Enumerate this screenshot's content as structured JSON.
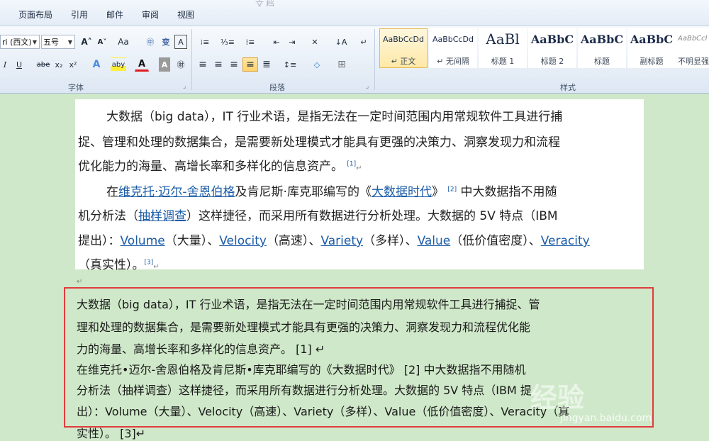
{
  "title_fragment": "文档",
  "tabs": [
    "页面布局",
    "引用",
    "邮件",
    "审阅",
    "视图"
  ],
  "font": {
    "name_value": "ri (西文)",
    "size_value": "五号",
    "grow": "A˄",
    "shrink": "A˅",
    "case": "Aa",
    "phonetic": "㊥",
    "clear_format": "变",
    "border_char": "A"
  },
  "font_row2": {
    "italic": "I",
    "underline": "U",
    "strike": "abe",
    "subscript": "x₂",
    "superscript": "x²",
    "effects": "A",
    "highlight": "aby",
    "color": "A",
    "shading": "A",
    "encircle": "㊖"
  },
  "paragraph_glyphs": {
    "bullets": "⁝≡",
    "numbering": "⅓≡",
    "multilevel": "⁞≡",
    "decrease_indent": "⇤",
    "increase_indent": "⇥",
    "chinese_layout": "✕",
    "sort": "↓A",
    "show_marks": "↵",
    "align_left": "≡",
    "align_center": "≡",
    "align_right": "≡",
    "justify": "≡",
    "distributed": "≣",
    "line_spacing": "↕≡",
    "paint": "◇",
    "borders": "⊞"
  },
  "group_labels": {
    "font": "字体",
    "paragraph": "段落",
    "styles": "样式"
  },
  "styles": [
    {
      "sample": "AaBbCcDd",
      "label": "↵ 正文",
      "active": true
    },
    {
      "sample": "AaBbCcDd",
      "label": "↵ 无间隔",
      "active": false
    },
    {
      "sample": "AaBl",
      "label": "标题 1",
      "active": false
    },
    {
      "sample": "AaBbC",
      "label": "标题 2",
      "active": false
    },
    {
      "sample": "AaBbC",
      "label": "标题",
      "active": false
    },
    {
      "sample": "AaBbC",
      "label": "副标题",
      "active": false
    },
    {
      "sample": "AaBbCcl",
      "label": "不明显强",
      "active": false
    }
  ],
  "top_doc": {
    "line1": "大数据（big data），IT 行业术语，是指无法在一定时间范围内用常规软件工具进行捕",
    "line2": "捉、管理和处理的数据集合，是需要新处理模式才能具有更强的决策力、洞察发现力和流程",
    "line3": "优化能力的海量、高增长率和多样化的信息资产。",
    "ref1": "[1]",
    "l4_a": "在",
    "l4_link1": "维克托·迈尔-舍恩伯格",
    "l4_b": "及肯尼斯·库克耶编写的《",
    "l4_link2": "大数据时代",
    "l4_c": "》",
    "ref2": "[2]",
    "l4_d": " 中大数据指不用随",
    "l5_a": "机分析法（",
    "l5_link": "抽样调查",
    "l5_b": "）这样捷径，而采用所有数据进行分析处理。大数据的 5V 特点（IBM",
    "l6_a": "提出）：",
    "v1": "Volume",
    "l6_b": "（大量）、",
    "v2": "Velocity",
    "l6_c": "（高速）、",
    "v3": "Variety",
    "l6_d": "（多样）、",
    "v4": "Value",
    "l6_e": "（低价值密度）、",
    "v5": "Veracity",
    "l7": "（真实性）。",
    "ref3": "[3]",
    "para_mark": "↵"
  },
  "bottom_doc": {
    "line1": "大数据（big data），IT 行业术语，是指无法在一定时间范围内用常规软件工具进行捕捉、管",
    "line2": "理和处理的数据集合，是需要新处理模式才能具有更强的决策力、洞察发现力和流程优化能",
    "line3": "力的海量、高增长率和多样化的信息资产。  [1]  ↵",
    "line4": "在维克托•迈尔-舍恩伯格及肯尼斯•库克耶编写的《大数据时代》 [2]    中大数据指不用随机",
    "line5": "分析法（抽样调查）这样捷径，而采用所有数据进行分析处理。大数据的 5V 特点（IBM 提",
    "line6": "出）：Volume（大量）、Velocity（高速）、Variety（多样）、Value（低价值密度）、Veracity（真",
    "line7": "实性）。 [3]↵"
  },
  "watermark": {
    "text": "经验",
    "url": "jingyan.baidu.com"
  }
}
